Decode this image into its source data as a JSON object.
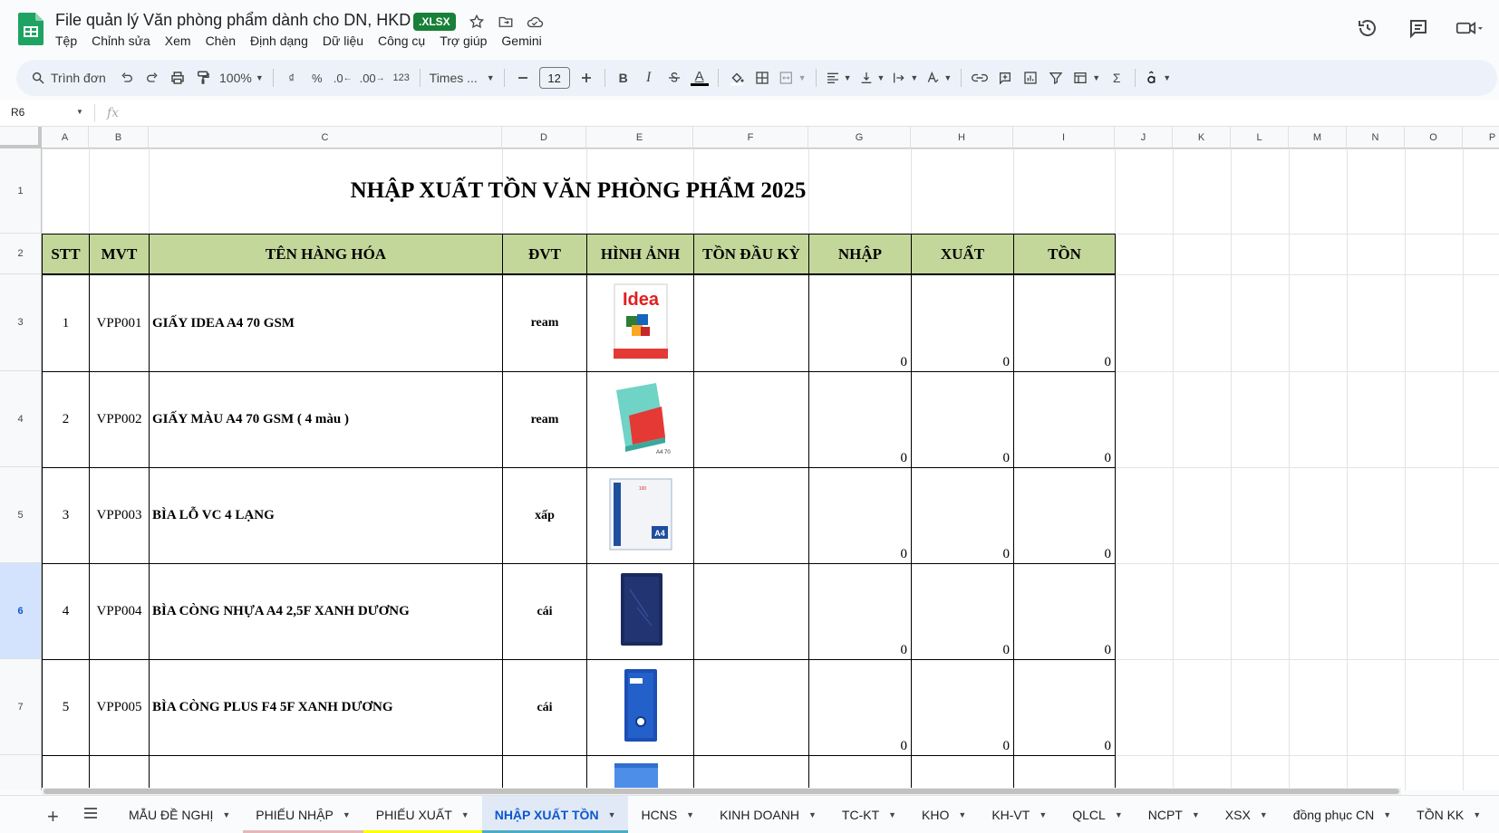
{
  "doc": {
    "title": "File quản lý Văn phòng phẩm dành cho DN, HKD",
    "badge": ".XLSX",
    "menu": [
      "Tệp",
      "Chỉnh sửa",
      "Xem",
      "Chèn",
      "Định dạng",
      "Dữ liệu",
      "Công cụ",
      "Trợ giúp",
      "Gemini"
    ]
  },
  "toolbar": {
    "search": "Trình đơn",
    "zoom": "100%",
    "currency": "₫",
    "percent": "%",
    "dec_less": ".0",
    "dec_more": ".00",
    "number_fmt": "123",
    "font": "Times ...",
    "font_size": "12",
    "bold": "B",
    "italic": "I",
    "text_color": "A",
    "sigma": "Σ"
  },
  "formula_bar": {
    "cell_ref": "R6",
    "fx": "fx"
  },
  "columns": [
    "A",
    "B",
    "C",
    "D",
    "E",
    "F",
    "G",
    "H",
    "I",
    "J",
    "K",
    "L",
    "M",
    "N",
    "O",
    "P"
  ],
  "rows": [
    "1",
    "2",
    "3",
    "4",
    "5",
    "6",
    "7"
  ],
  "selected_row": "6",
  "sheet": {
    "title": "NHẬP XUẤT TỒN VĂN PHÒNG PHẨM 2025",
    "headers": [
      "STT",
      "MVT",
      "TÊN HÀNG HÓA",
      "ĐVT",
      "HÌNH ẢNH",
      "TỒN ĐẦU KỲ",
      "NHẬP",
      "XUẤT",
      "TỒN"
    ],
    "items": [
      {
        "stt": "1",
        "mvt": "VPP001",
        "name": "GIẤY IDEA A4 70 GSM",
        "unit": "ream",
        "image": "idea-paper-ream",
        "image_text": "Idea",
        "nhap": "0",
        "xuat": "0",
        "ton": "0"
      },
      {
        "stt": "2",
        "mvt": "VPP002",
        "name": "GIẤY MÀU A4 70 GSM (  4 màu )",
        "unit": "ream",
        "image": "color-paper-ream",
        "image_text": "A4 70",
        "nhap": "0",
        "xuat": "0",
        "ton": "0"
      },
      {
        "stt": "3",
        "mvt": "VPP003",
        "name": "BÌA LỖ VC 4 LẠNG",
        "unit": "xấp",
        "image": "punched-sleeve-pack",
        "image_text": "A4",
        "nhap": "0",
        "xuat": "0",
        "ton": "0"
      },
      {
        "stt": "4",
        "mvt": "VPP004",
        "name": "BÌA CÒNG NHỰA A4 2,5F XANH DƯƠNG",
        "unit": "cái",
        "image": "blue-ring-binder",
        "image_text": "",
        "nhap": "0",
        "xuat": "0",
        "ton": "0"
      },
      {
        "stt": "5",
        "mvt": "VPP005",
        "name": "BÌA CÒNG PLUS F4 5F XANH DƯƠNG",
        "unit": "cái",
        "image": "blue-lever-arch-file",
        "image_text": "",
        "nhap": "0",
        "xuat": "0",
        "ton": "0"
      }
    ]
  },
  "tabs": [
    {
      "label": "MẪU ĐỀ NGHỊ",
      "color": ""
    },
    {
      "label": "PHIẾU NHẬP",
      "color": "#e6b8b7"
    },
    {
      "label": "PHIẾU XUẤT",
      "color": "#ffff00"
    },
    {
      "label": "NHẬP XUẤT TỒN",
      "color": "#4bacc6",
      "active": true
    },
    {
      "label": "HCNS",
      "color": ""
    },
    {
      "label": "KINH DOANH",
      "color": ""
    },
    {
      "label": "TC-KT",
      "color": ""
    },
    {
      "label": "KHO",
      "color": ""
    },
    {
      "label": "KH-VT",
      "color": ""
    },
    {
      "label": "QLCL",
      "color": ""
    },
    {
      "label": "NCPT",
      "color": ""
    },
    {
      "label": "XSX",
      "color": ""
    },
    {
      "label": "đồng phục CN",
      "color": ""
    },
    {
      "label": "TỒN KK",
      "color": ""
    }
  ],
  "colors": {
    "header_fill": "#c4d79b",
    "accent": "#0b57d0",
    "sheets_green": "#188038"
  }
}
